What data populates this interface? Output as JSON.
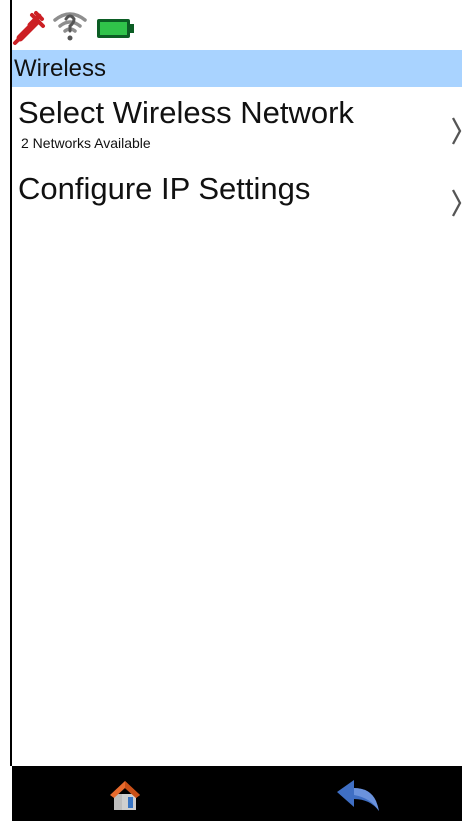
{
  "status_bar": {
    "icons": [
      "plug-disconnected-icon",
      "wifi-no-signal-icon",
      "battery-full-icon"
    ]
  },
  "header": {
    "title": "Wireless",
    "background_color": "#a9d3ff"
  },
  "menu": {
    "items": [
      {
        "title": "Select Wireless Network",
        "subtitle": "2 Networks Available",
        "icon": "chevron-right-icon"
      },
      {
        "title": "Configure IP Settings",
        "icon": "chevron-right-icon"
      }
    ]
  },
  "bottom_bar": {
    "home_icon": "home-icon",
    "back_icon": "back-arrow-icon",
    "background_color": "#000000"
  }
}
